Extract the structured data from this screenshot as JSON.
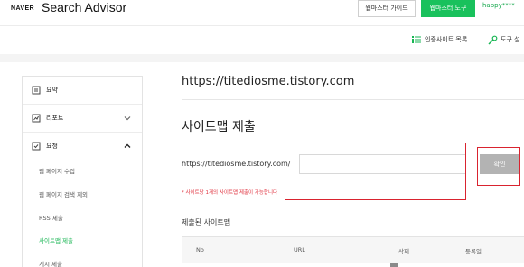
{
  "header": {
    "naver_logo": "NAVER",
    "title": "Search Advisor",
    "webmaster_guide_label": "웹마스터 가이드",
    "webmaster_tools_label": "웹마스터 도구",
    "user_label": "happy****"
  },
  "toolbar": {
    "certified_sites_label": "인증사이트 목록",
    "tools_label": "도구 설",
    "accent_color": "#19c15c"
  },
  "sidebar": {
    "items": [
      {
        "label": "요약",
        "icon": "summary-icon"
      },
      {
        "label": "리포트",
        "icon": "report-icon"
      },
      {
        "label": "요청",
        "icon": "request-icon"
      }
    ],
    "sub_items": [
      {
        "label": "웹 페이지 수집",
        "active": false
      },
      {
        "label": "웹 페이지 검색 제외",
        "active": false
      },
      {
        "label": "RSS 제출",
        "active": false
      },
      {
        "label": "사이트맵 제출",
        "active": true
      },
      {
        "label": "게시 제출",
        "active": false
      }
    ]
  },
  "main": {
    "site_url": "https://titediosme.tistory.com",
    "section_title": "사이트맵 제출",
    "submit_prefix": "https://titediosme.tistory.com/",
    "input_value": "",
    "confirm_label": "확인",
    "note": "* 사이트당 1개의 사이트맵 제출이 가능합니다",
    "list_title": "제출된 사이트맵",
    "table_headers": [
      "No",
      "URL",
      "삭제",
      "등록일"
    ],
    "highlight_color": "#d9232f"
  }
}
